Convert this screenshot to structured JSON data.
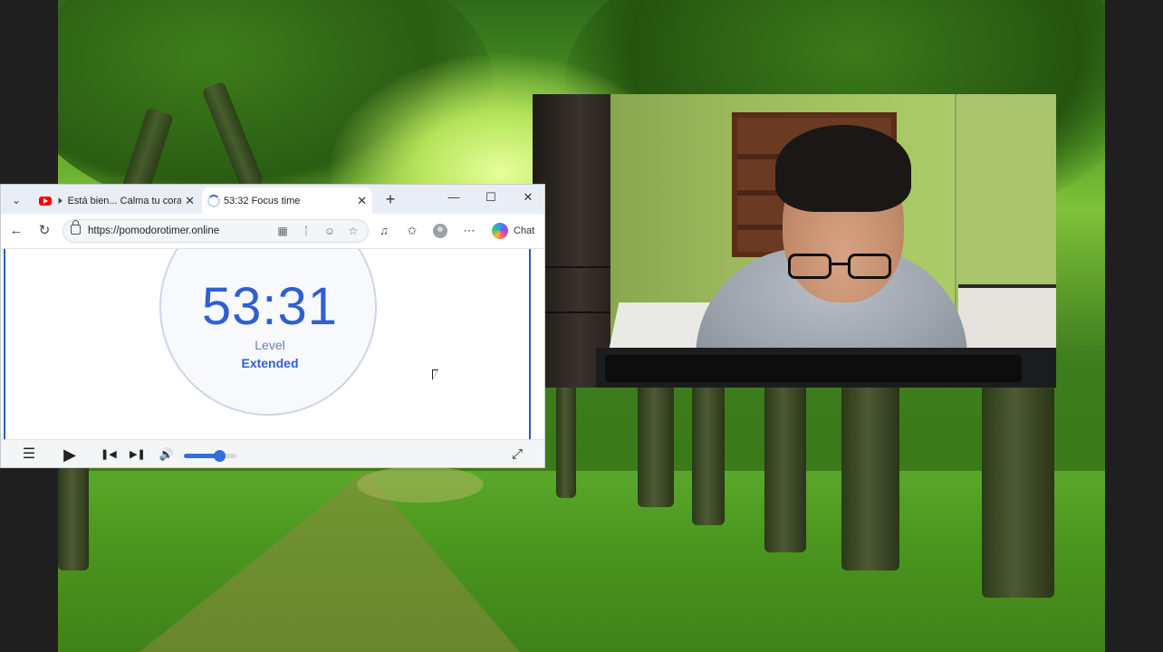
{
  "browser": {
    "tabs": [
      {
        "title": "Está bien... Calma tu cora",
        "favicon": "youtube-icon",
        "audio": "speaker-icon",
        "close": "✕"
      },
      {
        "title": "53:32 Focus time",
        "favicon": "loading-spinner-icon",
        "close": "✕"
      }
    ],
    "new_tab": "+",
    "window_controls": {
      "minimize": "—",
      "maximize": "☐",
      "close": "✕"
    },
    "address": {
      "url": "https://pomodorotimer.online",
      "back": "←",
      "reload": "↻"
    },
    "copilot_label": "Chat"
  },
  "timer": {
    "time": "53:31",
    "level_label": "Level",
    "level_value": "Extended"
  },
  "player": {
    "volume_fraction": 0.68
  },
  "colors": {
    "accent": "#2f5fd0",
    "volume": "#2f6fd8"
  }
}
